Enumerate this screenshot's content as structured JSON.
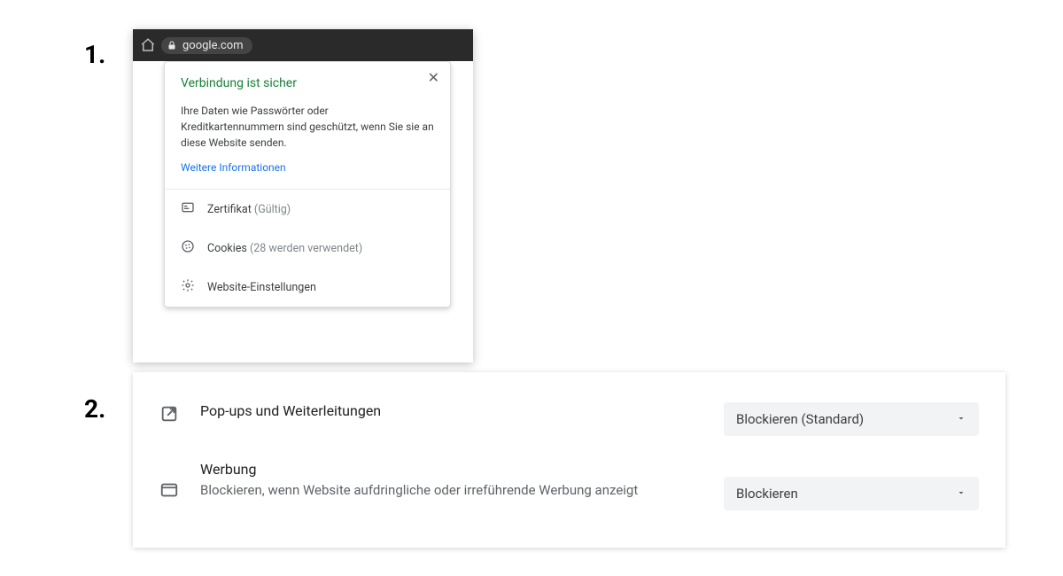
{
  "steps": {
    "one": "1.",
    "two": "2."
  },
  "address_bar": {
    "url": "google.com"
  },
  "popup": {
    "title": "Verbindung ist sicher",
    "description": "Ihre Daten wie Passwörter oder Kreditkartennummern sind geschützt, wenn Sie sie an diese Website senden.",
    "learn_more": "Weitere Informationen",
    "certificate_label": "Zertifikat",
    "certificate_status": "(Gültig)",
    "cookies_label": "Cookies",
    "cookies_status": "(28 werden verwendet)",
    "site_settings_label": "Website-Einstellungen"
  },
  "settings": {
    "popups": {
      "title": "Pop-ups und Weiterleitungen",
      "select_value": "Blockieren (Standard)"
    },
    "ads": {
      "title": "Werbung",
      "subtitle": "Blockieren, wenn Website aufdringliche oder irreführende Werbung anzeigt",
      "select_value": "Blockieren"
    }
  }
}
